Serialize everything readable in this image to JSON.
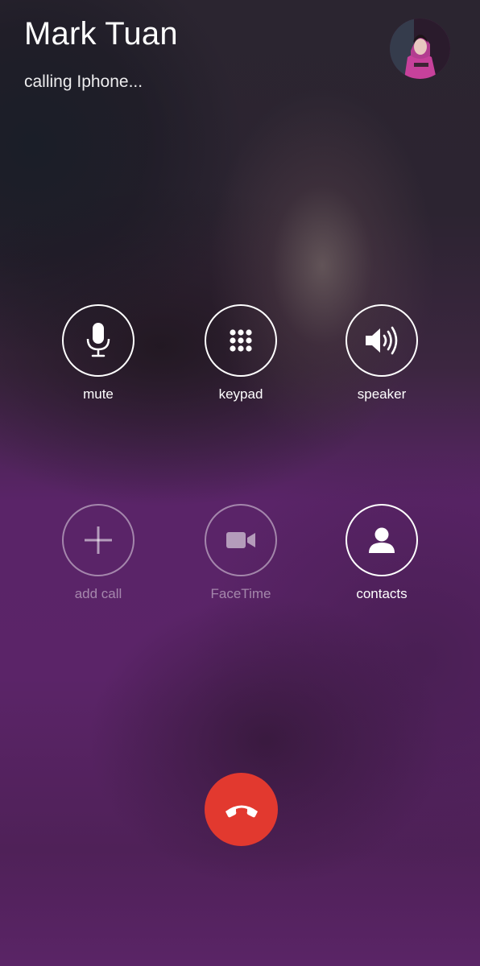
{
  "call": {
    "name": "Mark Tuan",
    "status": "calling Iphone..."
  },
  "controls": [
    {
      "label": "mute",
      "icon": "microphone-icon",
      "enabled": true
    },
    {
      "label": "keypad",
      "icon": "keypad-grid-icon",
      "enabled": true
    },
    {
      "label": "speaker",
      "icon": "speaker-icon",
      "enabled": true
    },
    {
      "label": "add call",
      "icon": "plus-icon",
      "enabled": false
    },
    {
      "label": "FaceTime",
      "icon": "video-camera-icon",
      "enabled": false
    },
    {
      "label": "contacts",
      "icon": "person-icon",
      "enabled": true
    }
  ],
  "end_call": {
    "icon": "phone-hangup-icon",
    "color": "#e2392f"
  },
  "colors": {
    "text": "#ffffff",
    "disabled": "rgba(255,255,255,0.45)",
    "end_call": "#e2392f",
    "background_purple": "#5a2468"
  }
}
